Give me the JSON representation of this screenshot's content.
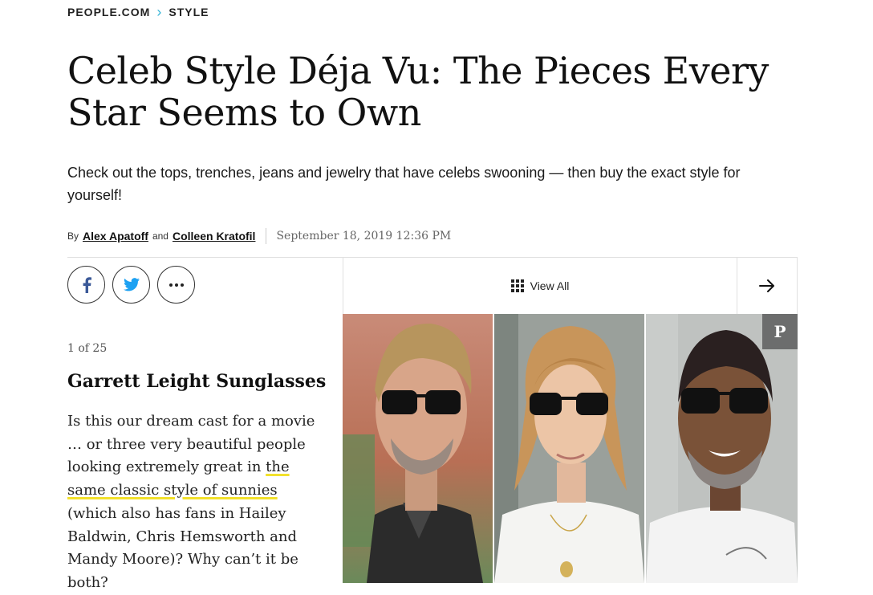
{
  "breadcrumb": {
    "site": "PEOPLE.COM",
    "section": "STYLE"
  },
  "headline": "Celeb Style Déja Vu: The Pieces Every Star Seems to Own",
  "dek": "Check out the tops, trenches, jeans and jewelry that have celebs swooning — then buy the exact style for yourself!",
  "byline": {
    "by": "By",
    "author1": "Alex Apatoff",
    "and": "and",
    "author2": "Colleen Kratofil",
    "date": "September 18, 2019 12:36 PM"
  },
  "share": {
    "facebook_icon": "facebook-icon",
    "twitter_icon": "twitter-icon",
    "more_icon": "more-dots-icon"
  },
  "gallery": {
    "view_all": "View All",
    "counter": "1 of 25",
    "slide_title": "Garrett Leight Sunglasses",
    "caption_before": "Is this our dream cast for a movie … or three very beautiful people looking extremely great in ",
    "caption_link": "the same classic style of sunnies",
    "caption_after": " (which also has fans in Hailey Baldwin, Chris Hemsworth and Mandy Moore)? Why can’t it be both?",
    "pin_label": "P"
  },
  "colors": {
    "accent_chevron": "#38b6d8",
    "highlight": "#f2e12b",
    "twitter": "#1da1f2",
    "facebook": "#3b5998"
  }
}
